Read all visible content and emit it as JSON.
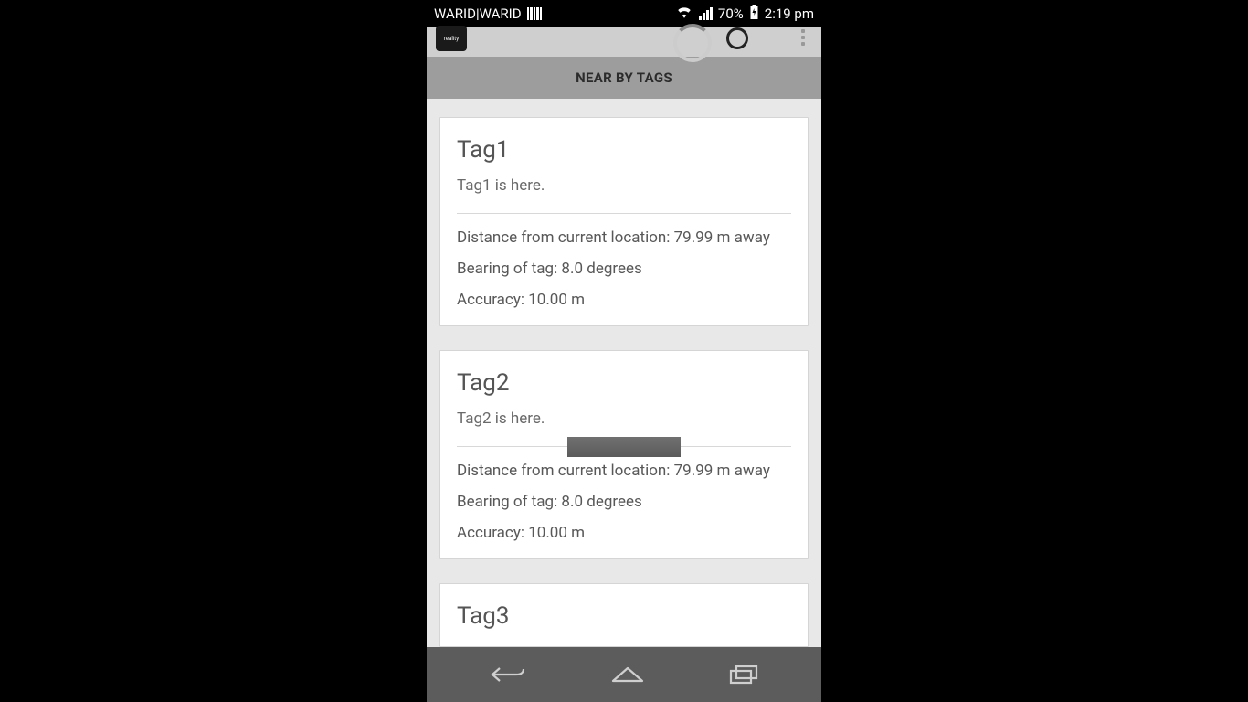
{
  "statusbar": {
    "carrier": "WARID|WARID",
    "battery_pct": "70%",
    "time": "2:19 pm"
  },
  "section_title": "NEAR BY TAGS",
  "labels": {
    "distance_prefix": "Distance from current location: ",
    "distance_suffix": " m away",
    "bearing_prefix": "Bearing of tag: ",
    "bearing_suffix": " degrees",
    "accuracy_prefix": "Accuracy: ",
    "accuracy_suffix": " m"
  },
  "tags": [
    {
      "title": "Tag1",
      "subtitle": "Tag1 is here.",
      "distance": "79.99",
      "bearing": "8.0",
      "accuracy": "10.00"
    },
    {
      "title": "Tag2",
      "subtitle": "Tag2 is here.",
      "distance": "79.99",
      "bearing": "8.0",
      "accuracy": "10.00"
    },
    {
      "title": "Tag3",
      "subtitle": "",
      "distance": "",
      "bearing": "",
      "accuracy": ""
    }
  ]
}
